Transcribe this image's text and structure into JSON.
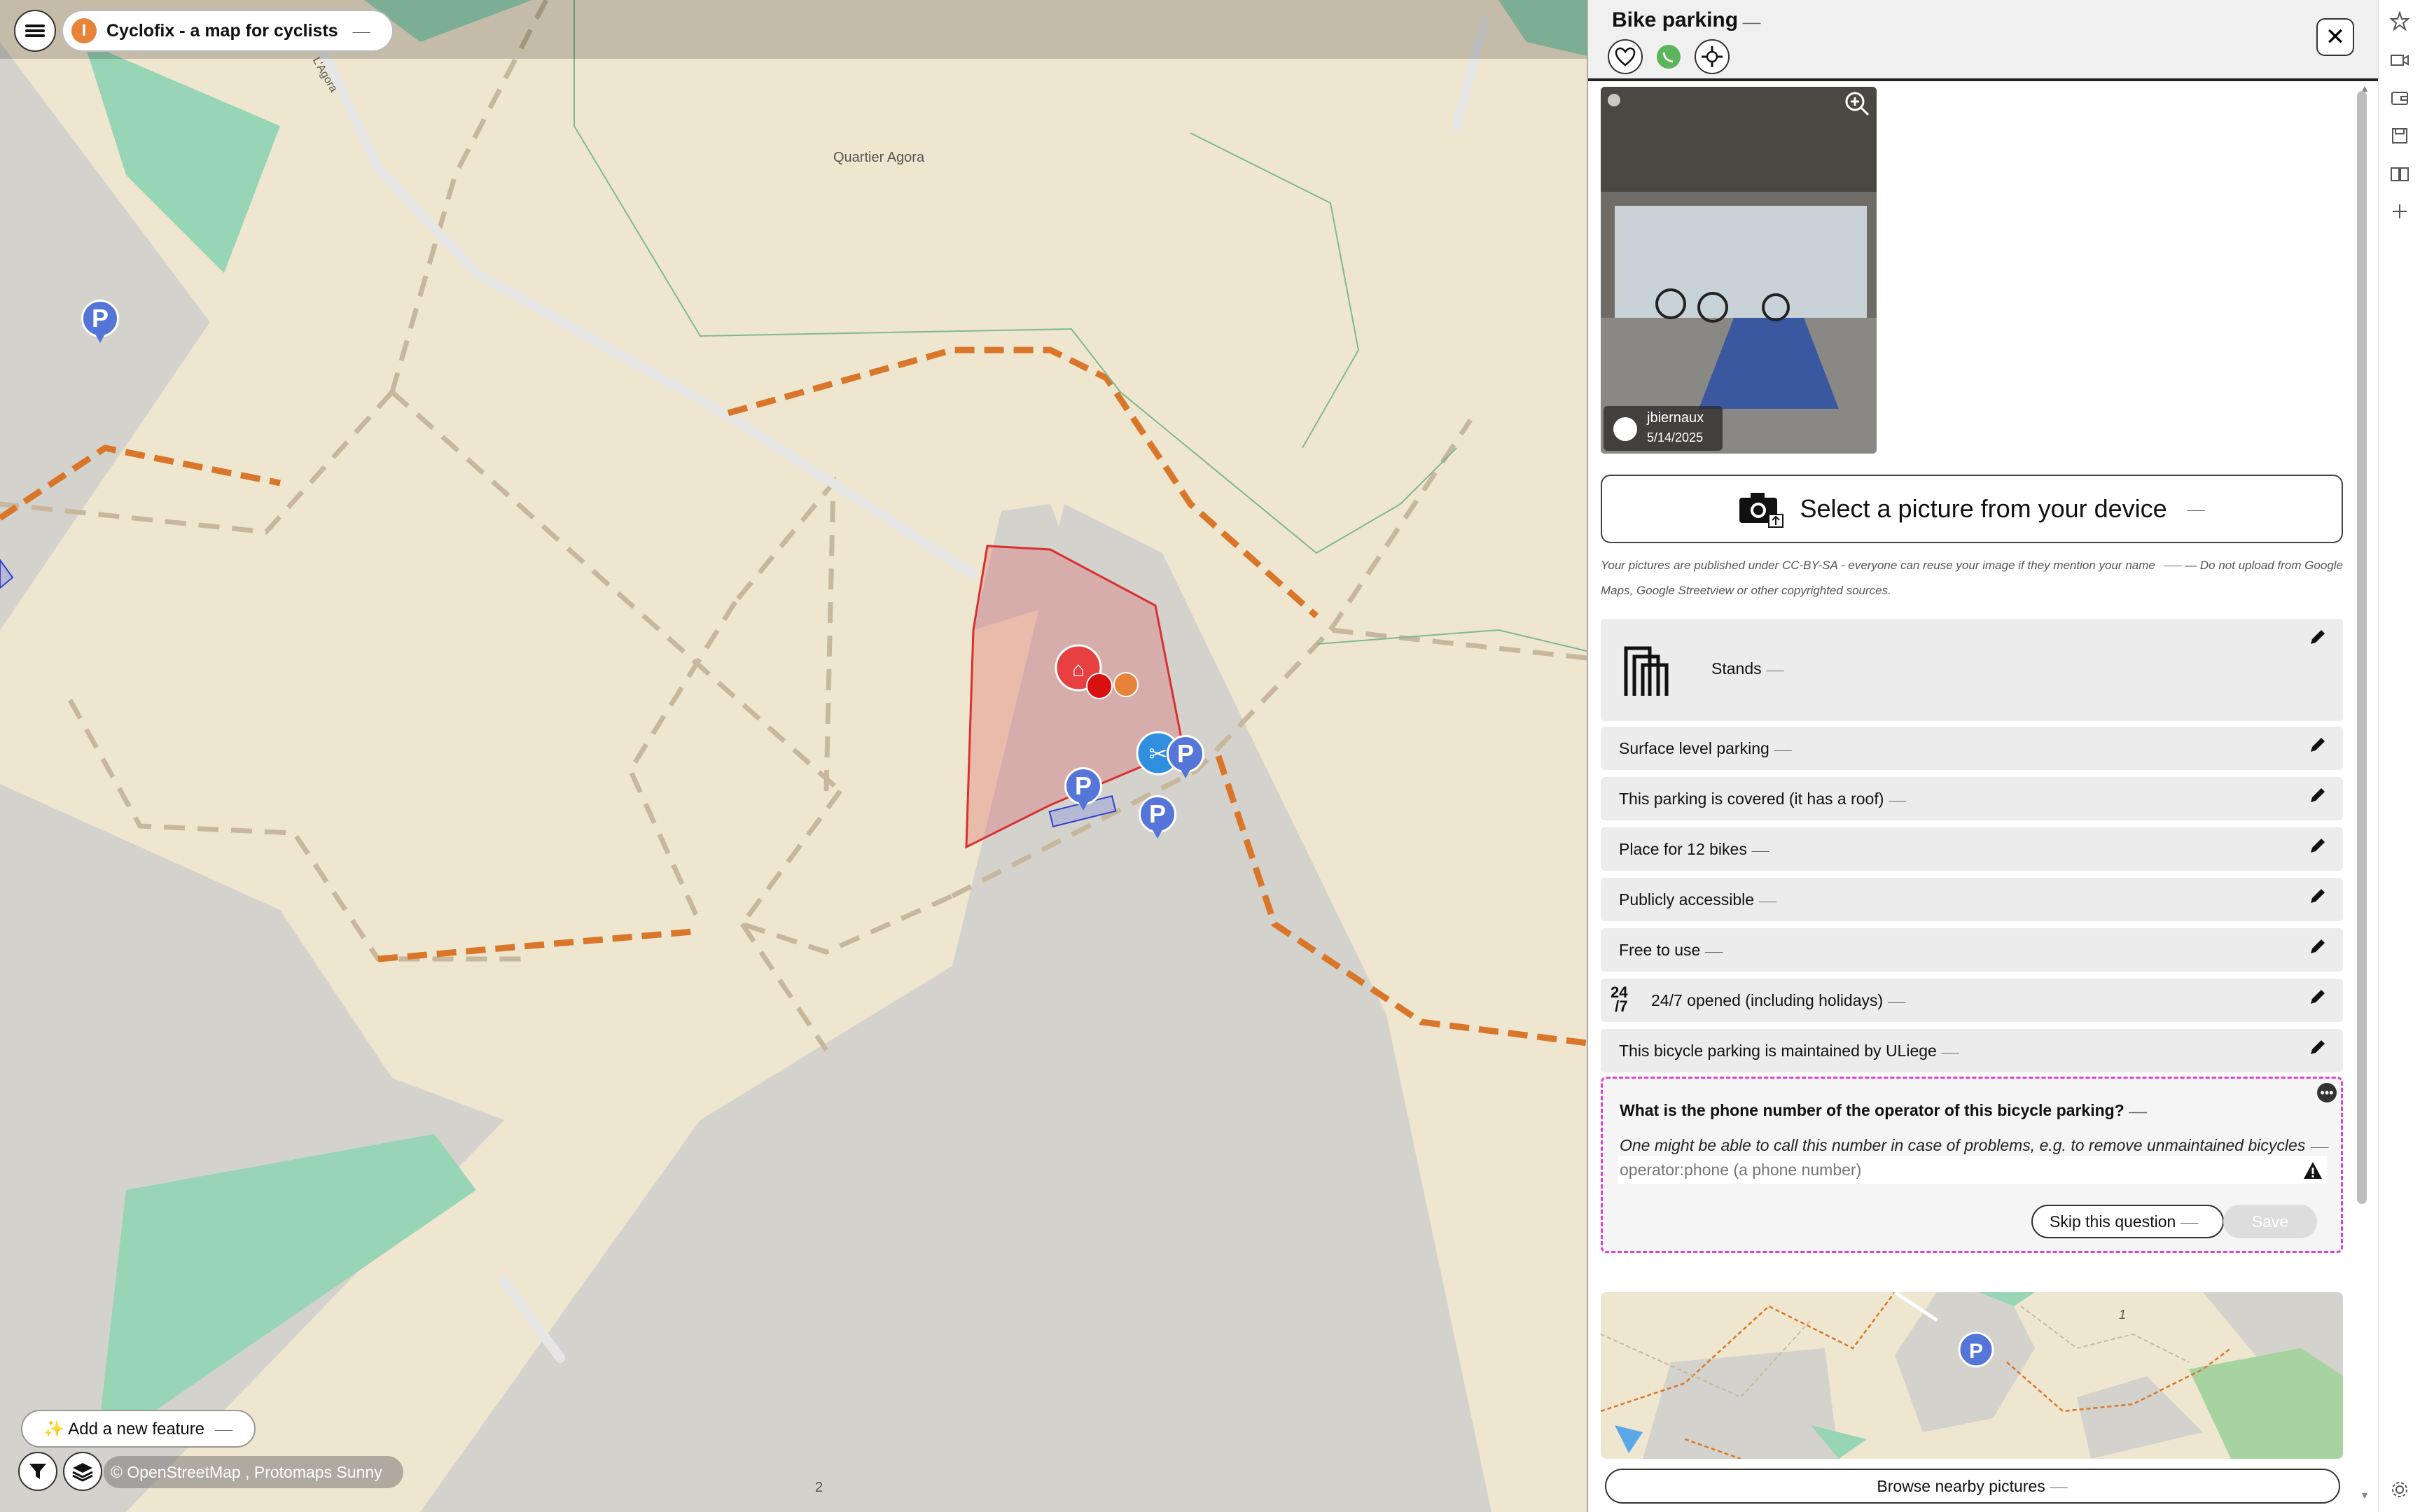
{
  "theme": {
    "title": "Cyclofix - a map for cyclists",
    "logo_letter": "I",
    "translate_mark": "⸺"
  },
  "map": {
    "labels": {
      "quartier": "Quartier Agora",
      "street": "L'Agora",
      "scale_number": "2"
    },
    "pin_letter": "P",
    "add_feature": "✨ Add a new feature",
    "attribution": "© OpenStreetMap , Protomaps Sunny"
  },
  "panel": {
    "title": "Bike parking",
    "photo": {
      "author": "jbiernaux",
      "date": "5/14/2025"
    },
    "upload_label": "Select a picture from your device",
    "license_text": "Your pictures are published under CC-BY-SA - everyone can reuse your image if they mention your name",
    "license_text2": "— Do not upload from Google Maps, Google Streetview or other copyrighted sources.",
    "rows": [
      {
        "label": "Stands"
      },
      {
        "label": "Surface level parking"
      },
      {
        "label": "This parking is covered (it has a roof)"
      },
      {
        "label": "Place for 12 bikes"
      },
      {
        "label": "Publicly accessible"
      },
      {
        "label": "Free to use"
      },
      {
        "label": "24/7 opened (including holidays)"
      },
      {
        "label": "This bicycle parking is maintained by ULiege"
      }
    ],
    "question": {
      "title": "What is the phone number of the operator of this bicycle parking?",
      "help": "One might be able to call this number in case of problems, e.g. to remove unmaintained bicycles",
      "placeholder": "operator:phone (a phone number)",
      "skip_label": "Skip this question",
      "save_label": "Save"
    },
    "mini_map_number": "1",
    "browse_label": "Browse nearby pictures"
  },
  "colors": {
    "accent": "#e8833a",
    "pin": "#5575d8",
    "highlight": "#e040d0"
  }
}
